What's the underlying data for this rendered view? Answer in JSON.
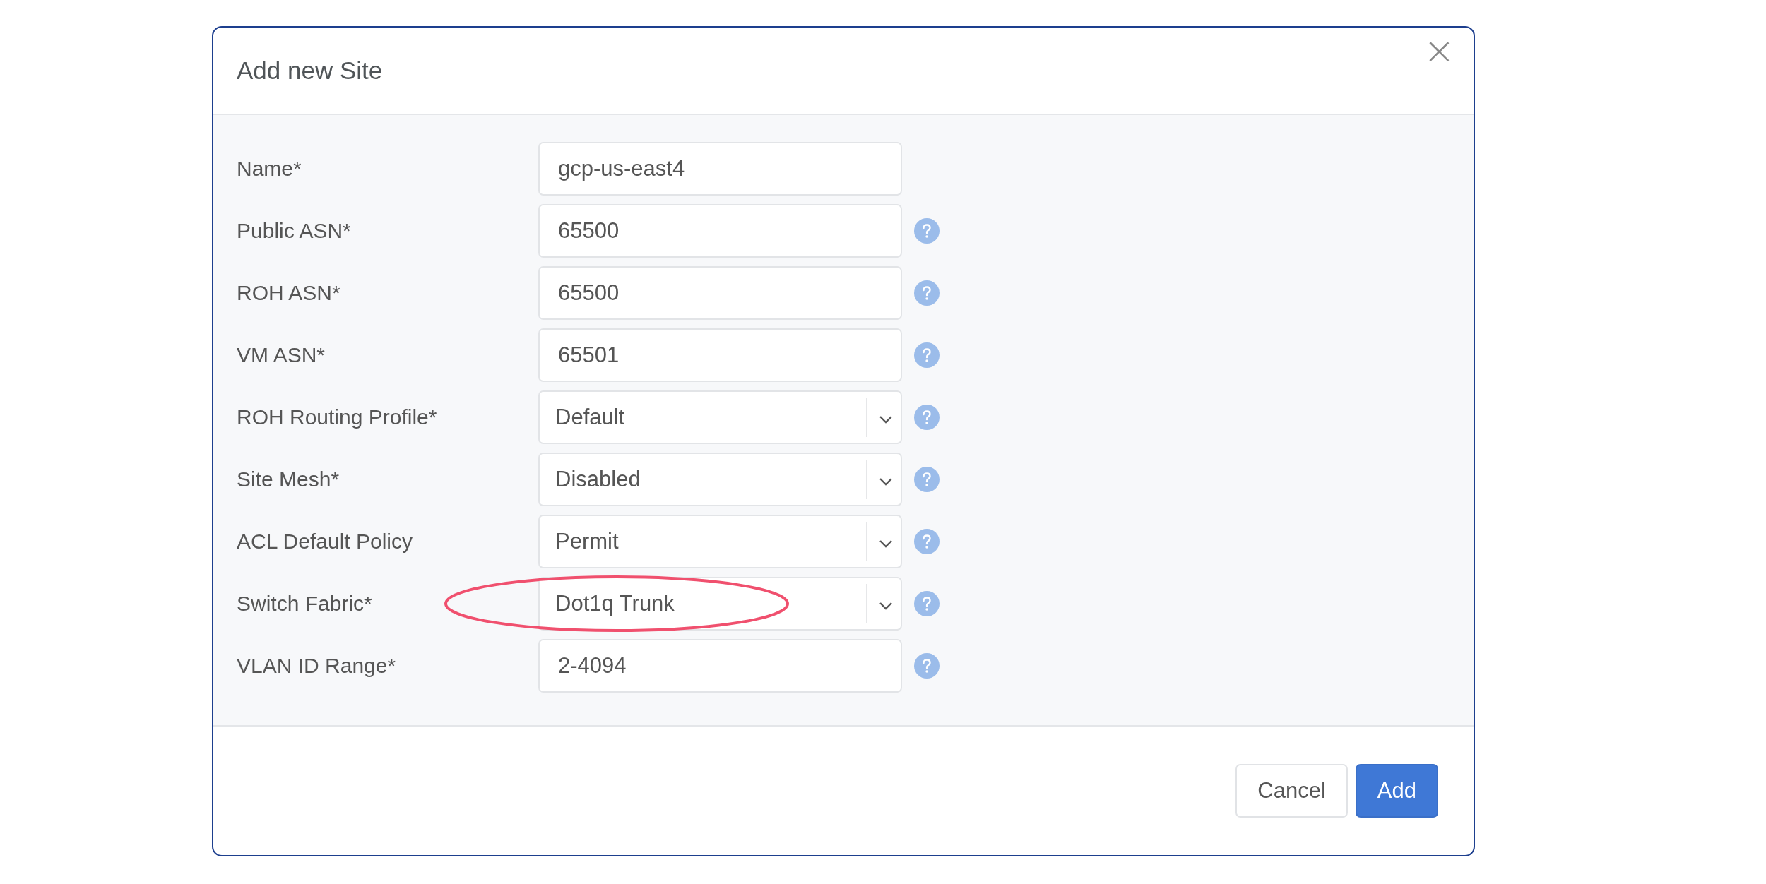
{
  "dialog": {
    "title": "Add new Site",
    "close": "×"
  },
  "fields": [
    {
      "label": "Name*",
      "kind": "text",
      "value": "gcp-us-east4",
      "help": false,
      "highlighted": false
    },
    {
      "label": "Public ASN*",
      "kind": "text",
      "value": "65500",
      "help": true,
      "highlighted": false
    },
    {
      "label": "ROH ASN*",
      "kind": "text",
      "value": "65500",
      "help": true,
      "highlighted": false
    },
    {
      "label": "VM ASN*",
      "kind": "text",
      "value": "65501",
      "help": true,
      "highlighted": false
    },
    {
      "label": "ROH Routing Profile*",
      "kind": "select",
      "value": "Default",
      "help": true,
      "highlighted": false
    },
    {
      "label": "Site Mesh*",
      "kind": "select",
      "value": "Disabled",
      "help": true,
      "highlighted": false
    },
    {
      "label": "ACL Default Policy",
      "kind": "select",
      "value": "Permit",
      "help": true,
      "highlighted": false
    },
    {
      "label": "Switch Fabric*",
      "kind": "select",
      "value": "Dot1q Trunk",
      "help": true,
      "highlighted": true
    },
    {
      "label": "VLAN ID Range*",
      "kind": "text",
      "value": "2-4094",
      "help": true,
      "highlighted": false
    }
  ],
  "buttons": [
    {
      "label": "Cancel",
      "kind": "secondary"
    },
    {
      "label": "Add",
      "kind": "primary"
    }
  ]
}
